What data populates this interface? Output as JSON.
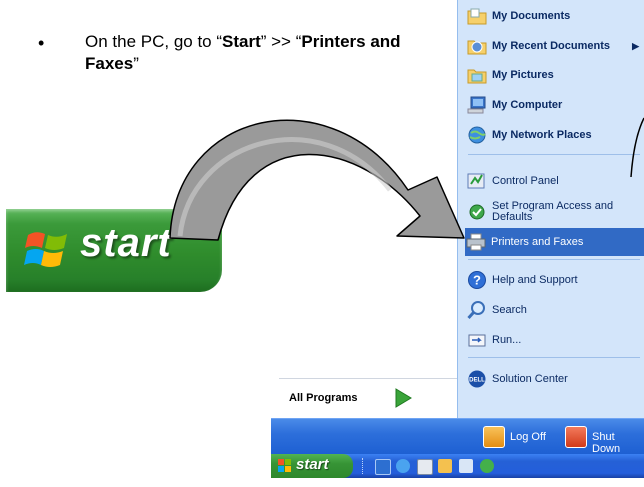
{
  "instruction": {
    "bullet": "•",
    "prefix": "On the PC, go to “",
    "start": "Start",
    "mid": "” >> “",
    "printers": "Printers and Faxes",
    "suffix": "”"
  },
  "big_start_button": {
    "label": "start"
  },
  "start_menu": {
    "right_column": [
      {
        "label": "My Documents",
        "icon": "folder-documents-icon"
      },
      {
        "label": "My Recent Documents",
        "icon": "recent-documents-icon"
      },
      {
        "label": "My Pictures",
        "icon": "folder-pictures-icon"
      },
      {
        "label": "My Computer",
        "icon": "computer-icon"
      },
      {
        "label": "My Network Places",
        "icon": "network-places-icon"
      },
      {
        "label": "Control Panel",
        "icon": "control-panel-icon"
      },
      {
        "label": "Set Program Access and Defaults",
        "icon": "program-access-icon"
      },
      {
        "label": "Printers and Faxes",
        "icon": "printer-icon",
        "selected": true
      },
      {
        "label": "Help and Support",
        "icon": "help-icon"
      },
      {
        "label": "Search",
        "icon": "search-icon"
      },
      {
        "label": "Run...",
        "icon": "run-icon"
      },
      {
        "label": "Solution Center",
        "icon": "dell-icon"
      }
    ],
    "all_programs": "All Programs",
    "log_off": "Log Off",
    "shut_down": "Shut Down"
  },
  "taskbar": {
    "start_label": "start"
  },
  "colors": {
    "menu_right_bg": "#d3e5fa",
    "selection": "#316ac5",
    "start_green": "#2f8c2c",
    "taskbar_blue": "#245edb"
  }
}
